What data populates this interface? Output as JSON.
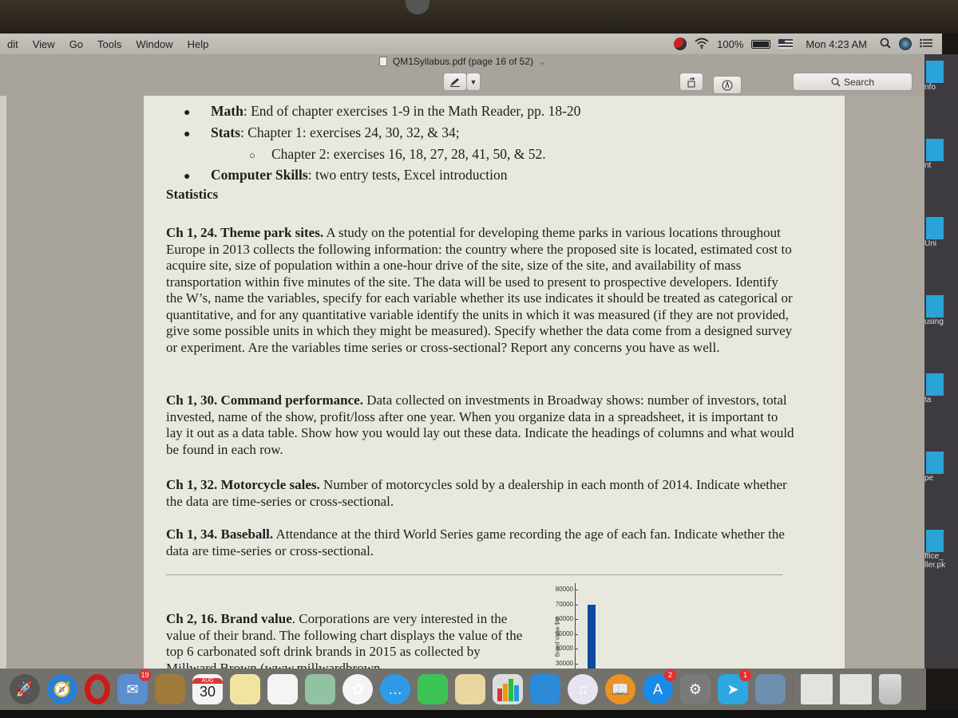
{
  "menubar": {
    "items": [
      "dit",
      "View",
      "Go",
      "Tools",
      "Window",
      "Help"
    ],
    "battery": "100%",
    "clock": "Mon 4:23 AM"
  },
  "window": {
    "title": "QM1Syllabus.pdf (page 16 of 52)",
    "title_chevron": "⌄",
    "search_placeholder": "Search"
  },
  "document": {
    "bullets": [
      {
        "label": "Math",
        "text": ": End of chapter exercises 1-9 in the Math Reader, pp. 18-20"
      },
      {
        "label": "Stats",
        "text": ":   Chapter 1: exercises 24, 30, 32, & 34;"
      },
      {
        "label": "",
        "text": "Chapter 2: exercises 16, 18, 27, 28, 41, 50, & 52.",
        "sub": true
      },
      {
        "label": "Computer Skills",
        "text": ":   two entry tests, Excel introduction"
      }
    ],
    "section_heading": "Statistics",
    "exercises": [
      {
        "title": "Ch 1, 24. Theme park sites.",
        "body": " A study on the potential for developing theme parks in various locations throughout Europe in 2013 collects the following information: the country where the proposed site is located, estimated cost to acquire site, size of population within a one-hour drive of the site, size of the site, and availability of mass transportation within five minutes of the site. The data will be used to present to prospective developers. Identify the W’s, name the variables, specify for each variable whether its use indicates it should be treated as categorical or quantitative, and for any quantitative variable identify the units in which it was measured (if they are not provided, give some possible units in which they might be measured). Specify whether the data come from a designed survey or experiment. Are the variables time series or cross-sectional? Report any concerns you have as well."
      },
      {
        "title": "Ch 1, 30. Command performance.",
        "body": " Data collected on investments in Broadway shows: number of investors, total invested, name of the show, profit/loss after one year. When you organize data in a spreadsheet, it is important to lay it out as a data table. Show how you would lay out these data. Indicate the headings of columns and what would be found in each row."
      },
      {
        "title": "Ch 1, 32. Motorcycle sales.",
        "body": " Number of motorcycles sold by a dealership in each month of 2014. Indicate whether the data are time-series or cross-sectional."
      },
      {
        "title": "Ch 1, 34. Baseball.",
        "body": " Attendance at the third World Series game recording the age of each fan. Indicate whether the data are time-series or cross-sectional."
      },
      {
        "title": "Ch 2, 16. Brand value",
        "body": ". Corporations are very interested in the value of their brand. The following chart displays the value of the top 6 carbonated soft drink brands in 2015 as collected by Millward Brown (www.millwardbrown"
      }
    ],
    "mini_chart": {
      "ylabel": "Brand Value $M",
      "ticks": [
        "80000",
        "70000",
        "60000",
        "50000",
        "40000",
        "30000"
      ],
      "visible_bar_value": 70000,
      "bar_color": "#0e4aa0"
    }
  },
  "desktop_items": [
    "nfo",
    "nt",
    "Uni",
    "using",
    "ta",
    "pe",
    "ffice_\nller.pk"
  ],
  "dock": {
    "apps": [
      {
        "name": "launchpad",
        "glyph": "🚀",
        "bg": "#555"
      },
      {
        "name": "safari",
        "glyph": "🧭",
        "bg": "#2a7fd4"
      },
      {
        "name": "opera",
        "glyph": "O",
        "bg": "#d01818"
      },
      {
        "name": "mail",
        "glyph": "✉",
        "bg": "#5a8fcf",
        "badge": "19"
      },
      {
        "name": "contacts",
        "glyph": "",
        "bg": "#a07a3a"
      },
      {
        "name": "calendar",
        "glyph": "30",
        "bg": "#f4f4f4",
        "month": "AUG"
      },
      {
        "name": "notes",
        "glyph": "",
        "bg": "#f1e4a0"
      },
      {
        "name": "reminders",
        "glyph": "",
        "bg": "#f4f4f4"
      },
      {
        "name": "maps",
        "glyph": "",
        "bg": "#8fc3a2"
      },
      {
        "name": "photos",
        "glyph": "✿",
        "bg": "#f4f4f4"
      },
      {
        "name": "messages",
        "glyph": "…",
        "bg": "#2f9be8"
      },
      {
        "name": "facetime",
        "glyph": "",
        "bg": "#3bc454"
      },
      {
        "name": "preview-doc",
        "glyph": "",
        "bg": "#e8d7a0"
      },
      {
        "name": "numbers",
        "glyph": "",
        "bg": "#dcdcdc"
      },
      {
        "name": "keynote",
        "glyph": "",
        "bg": "#2d8ad8"
      },
      {
        "name": "itunes",
        "glyph": "♫",
        "bg": "#e7e3f0"
      },
      {
        "name": "ibooks",
        "glyph": "📖",
        "bg": "#e89420"
      },
      {
        "name": "app-store",
        "glyph": "A",
        "bg": "#1a8ae8",
        "badge": "2"
      },
      {
        "name": "system-preferences",
        "glyph": "⚙",
        "bg": "#7a7a7a"
      },
      {
        "name": "telegram",
        "glyph": "➤",
        "bg": "#2da7e0",
        "badge": "1"
      },
      {
        "name": "preview",
        "glyph": "",
        "bg": "#6d8fb0"
      }
    ],
    "stacks": [
      "document-stack-1",
      "document-stack-2",
      "trash"
    ]
  }
}
